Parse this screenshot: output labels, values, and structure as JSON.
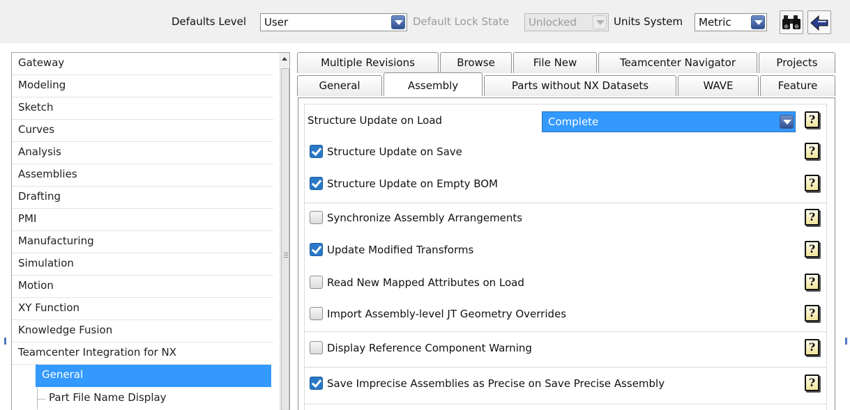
{
  "toolbar": {
    "defaults_level_label": "Defaults Level",
    "defaults_level_value": "User",
    "lock_state_label": "Default Lock State",
    "lock_state_value": "Unlocked",
    "units_label": "Units System",
    "units_value": "Metric",
    "icons": [
      "binoculars-icon",
      "back-arrow-icon"
    ]
  },
  "tree": {
    "items": [
      "Gateway",
      "Modeling",
      "Sketch",
      "Curves",
      "Analysis",
      "Assemblies",
      "Drafting",
      "PMI",
      "Manufacturing",
      "Simulation",
      "Motion",
      "XY Function",
      "Knowledge Fusion",
      "Teamcenter Integration for NX"
    ],
    "children": [
      "General",
      "Part File Name Display"
    ],
    "selected": "General"
  },
  "tabs": {
    "row1": [
      "Multiple Revisions",
      "Browse",
      "File New",
      "Teamcenter Navigator",
      "Projects"
    ],
    "row2": [
      "General",
      "Assembly",
      "Parts without NX Datasets",
      "WAVE",
      "Feature"
    ],
    "active": "Assembly"
  },
  "settings": {
    "structure_update_on_load_label": "Structure Update on Load",
    "structure_update_on_load_value": "Complete",
    "options": [
      {
        "label": "Structure Update on Save",
        "checked": true
      },
      {
        "label": "Structure Update on Empty BOM",
        "checked": true
      },
      {
        "label": "Synchronize Assembly Arrangements",
        "checked": false
      },
      {
        "label": "Update Modified Transforms",
        "checked": true
      },
      {
        "label": "Read New Mapped Attributes on Load",
        "checked": false
      },
      {
        "label": "Import Assembly-level JT Geometry Overrides",
        "checked": false
      },
      {
        "label": "Display Reference Component Warning",
        "checked": false
      },
      {
        "label": "Save Imprecise Assemblies as Precise on Save Precise Assembly",
        "checked": true
      }
    ],
    "help_glyph": "?"
  },
  "colors": {
    "selection": "#3399ff",
    "checkbox_checked": "#2a79c8",
    "help_bg": "#f1e39a"
  }
}
